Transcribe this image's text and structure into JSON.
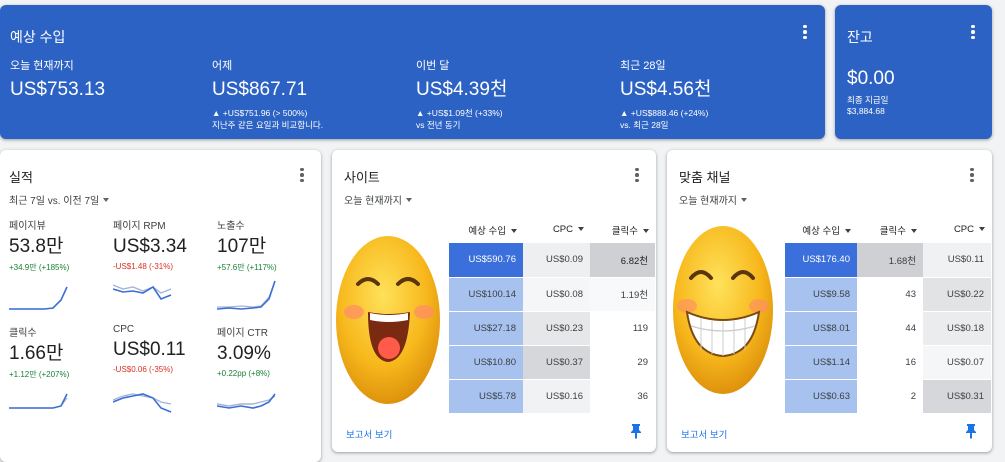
{
  "earnings": {
    "title": "예상 수입",
    "metrics": [
      {
        "label": "오늘 현재까지",
        "value": "US$753.13",
        "line1": "",
        "line2": ""
      },
      {
        "label": "어제",
        "value": "US$867.71",
        "line1": "▲ +US$751.96 (> 500%)",
        "line2": "지난주 같은 요일과 비교합니다."
      },
      {
        "label": "이번 달",
        "value": "US$4.39천",
        "line1": "▲ +US$1.09천 (+33%)",
        "line2": "vs 전년 동기"
      },
      {
        "label": "최근 28일",
        "value": "US$4.56천",
        "line1": "▲ +US$888.46 (+24%)",
        "line2": "vs. 최근 28일"
      }
    ]
  },
  "balance": {
    "title": "잔고",
    "value": "$0.00",
    "sub_label": "최종 지급일",
    "sub_value": "$3,884.68"
  },
  "performance": {
    "title": "실적",
    "range": "최근 7일 vs. 이전 7일",
    "metrics": [
      {
        "label": "페이지뷰",
        "value": "53.8만",
        "change": "+34.9만 (+185%)",
        "trend": "up"
      },
      {
        "label": "페이지 RPM",
        "value": "US$3.34",
        "change": "-US$1.48 (-31%)",
        "trend": "down"
      },
      {
        "label": "노출수",
        "value": "107만",
        "change": "+57.6만 (+117%)",
        "trend": "up"
      },
      {
        "label": "클릭수",
        "value": "1.66만",
        "change": "+1.12만 (+207%)",
        "trend": "up"
      },
      {
        "label": "CPC",
        "value": "US$0.11",
        "change": "-US$0.06 (-35%)",
        "trend": "down"
      },
      {
        "label": "페이지 CTR",
        "value": "3.09%",
        "change": "+0.22pp (+8%)",
        "trend": "up"
      }
    ]
  },
  "sites": {
    "title": "사이트",
    "range": "오늘 현재까지",
    "columns": [
      "예상 수입",
      "CPC",
      "클릭수"
    ],
    "rows": [
      [
        "US$590.76",
        "US$0.09",
        "6.82천"
      ],
      [
        "US$100.14",
        "US$0.08",
        "1.19천"
      ],
      [
        "US$27.18",
        "US$0.23",
        "119"
      ],
      [
        "US$10.80",
        "US$0.37",
        "29"
      ],
      [
        "US$5.78",
        "US$0.16",
        "36"
      ]
    ],
    "report_link": "보고서 보기"
  },
  "channels": {
    "title": "맞춤 채널",
    "range": "오늘 현재까지",
    "columns": [
      "예상 수입",
      "클릭수",
      "CPC"
    ],
    "rows": [
      [
        "US$176.40",
        "1.68천",
        "US$0.11"
      ],
      [
        "US$9.58",
        "43",
        "US$0.22"
      ],
      [
        "US$8.01",
        "44",
        "US$0.18"
      ],
      [
        "US$1.14",
        "16",
        "US$0.07"
      ],
      [
        "US$0.63",
        "2",
        "US$0.31"
      ]
    ],
    "report_link": "보고서 보기"
  },
  "icons": {
    "more": "more-vert-icon",
    "dropdown": "caret-down-icon",
    "pin": "pin-icon"
  },
  "colors": {
    "brand_blue": "#2c62c4",
    "positive": "#188038",
    "negative": "#d93025",
    "link": "#1a73e8"
  }
}
